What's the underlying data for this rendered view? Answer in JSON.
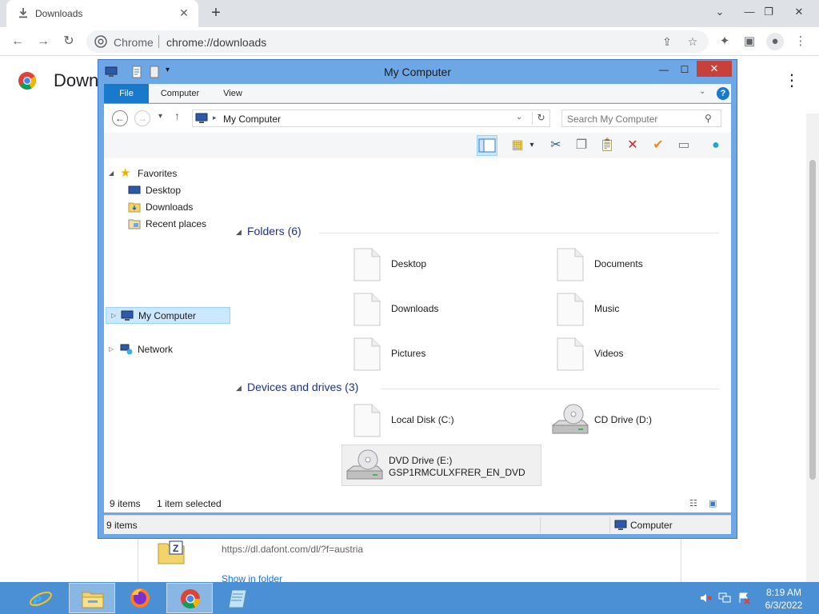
{
  "chrome": {
    "tab_title": "Downloads",
    "site_name": "Chrome",
    "url": "chrome://downloads",
    "page_title": "Downloads",
    "download_url": "https://dl.dafont.com/dl/?f=austria",
    "show_in_folder": "Show in folder"
  },
  "explorer": {
    "title": "My Computer",
    "ribbon_tabs": [
      "File",
      "Computer",
      "View"
    ],
    "address": "My Computer",
    "search_placeholder": "Search My Computer",
    "nav": {
      "favorites": "Favorites",
      "desktop": "Desktop",
      "downloads": "Downloads",
      "recent": "Recent places",
      "my_computer": "My Computer",
      "network": "Network"
    },
    "groups": {
      "folders": "Folders (6)",
      "devices": "Devices and drives (3)"
    },
    "folders": [
      "Desktop",
      "Documents",
      "Downloads",
      "Music",
      "Pictures",
      "Videos"
    ],
    "drives": {
      "local": "Local Disk (C:)",
      "cd": "CD Drive (D:)",
      "dvd": "DVD Drive (E:)",
      "dvd_label": "GSP1RMCULXFRER_EN_DVD"
    },
    "bottom": {
      "items": "9 items",
      "selected": "1 item selected"
    },
    "status": {
      "left": "9 items",
      "right": "Computer"
    }
  },
  "taskbar": {
    "time": "8:19 AM",
    "date": "6/3/2022"
  },
  "colors": {
    "window_frame": "#6ea7e6",
    "ribbon_file": "#1979ca",
    "close_button": "#c7403a",
    "taskbar": "#4b8fd5",
    "selection": "#cce8ff"
  }
}
